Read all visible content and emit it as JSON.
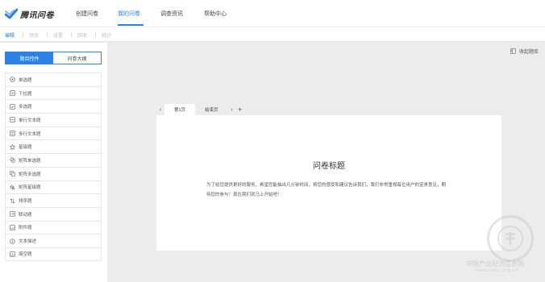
{
  "app": {
    "logo_text": "腾讯问卷",
    "brand_color": "#2b82e4"
  },
  "nav": {
    "items": [
      {
        "label": "创建问卷",
        "active": false
      },
      {
        "label": "我的问卷",
        "active": true
      },
      {
        "label": "调查资讯",
        "active": false
      },
      {
        "label": "帮助中心",
        "active": false
      }
    ]
  },
  "toolbar": {
    "items": [
      {
        "label": "编辑",
        "active": true
      },
      {
        "label": "预览",
        "active": false
      },
      {
        "label": "设置",
        "active": false
      },
      {
        "label": "回收",
        "active": false
      },
      {
        "label": "统计",
        "active": false
      }
    ]
  },
  "sidebar": {
    "tabs": [
      {
        "label": "题目控件",
        "active": true
      },
      {
        "label": "问卷大纲",
        "active": false
      }
    ],
    "questions": [
      {
        "label": "单选题",
        "icon": "radio-icon"
      },
      {
        "label": "下拉题",
        "icon": "dropdown-icon"
      },
      {
        "label": "多选题",
        "icon": "checkbox-icon"
      },
      {
        "label": "单行文本题",
        "icon": "single-line-text-icon"
      },
      {
        "label": "多行文本题",
        "icon": "multi-line-text-icon"
      },
      {
        "label": "星级题",
        "icon": "star-icon"
      },
      {
        "label": "矩阵单选题",
        "icon": "matrix-radio-icon"
      },
      {
        "label": "矩阵多选题",
        "icon": "matrix-checkbox-icon"
      },
      {
        "label": "矩阵星级题",
        "icon": "matrix-star-icon"
      },
      {
        "label": "排序题",
        "icon": "sort-icon"
      },
      {
        "label": "联动题",
        "icon": "linkage-icon"
      },
      {
        "label": "附件题",
        "icon": "attachment-icon"
      },
      {
        "label": "文本描述",
        "icon": "text-description-icon"
      },
      {
        "label": "填空题",
        "icon": "fill-blank-icon"
      }
    ]
  },
  "outline_toggle": {
    "label": "收起题库",
    "icon": "collapse-icon"
  },
  "pages": {
    "prev_icon": "‹",
    "next_icon": "›",
    "add_icon": "+",
    "tabs": [
      {
        "label": "第1页",
        "active": true
      },
      {
        "label": "结束页",
        "active": false
      }
    ]
  },
  "survey": {
    "title": "问卷标题",
    "intro": "为了给您提供更好的服务，希望您能抽出几分钟时间，将您的感受和建议告诉我们，我们非常重视每位用户的宝贵意见，期待您的参与！现在我们就马上开始吧！"
  },
  "watermark": {
    "text_cn": "中国产业经济信息网",
    "text_url": "www.cinic.org.cn"
  }
}
